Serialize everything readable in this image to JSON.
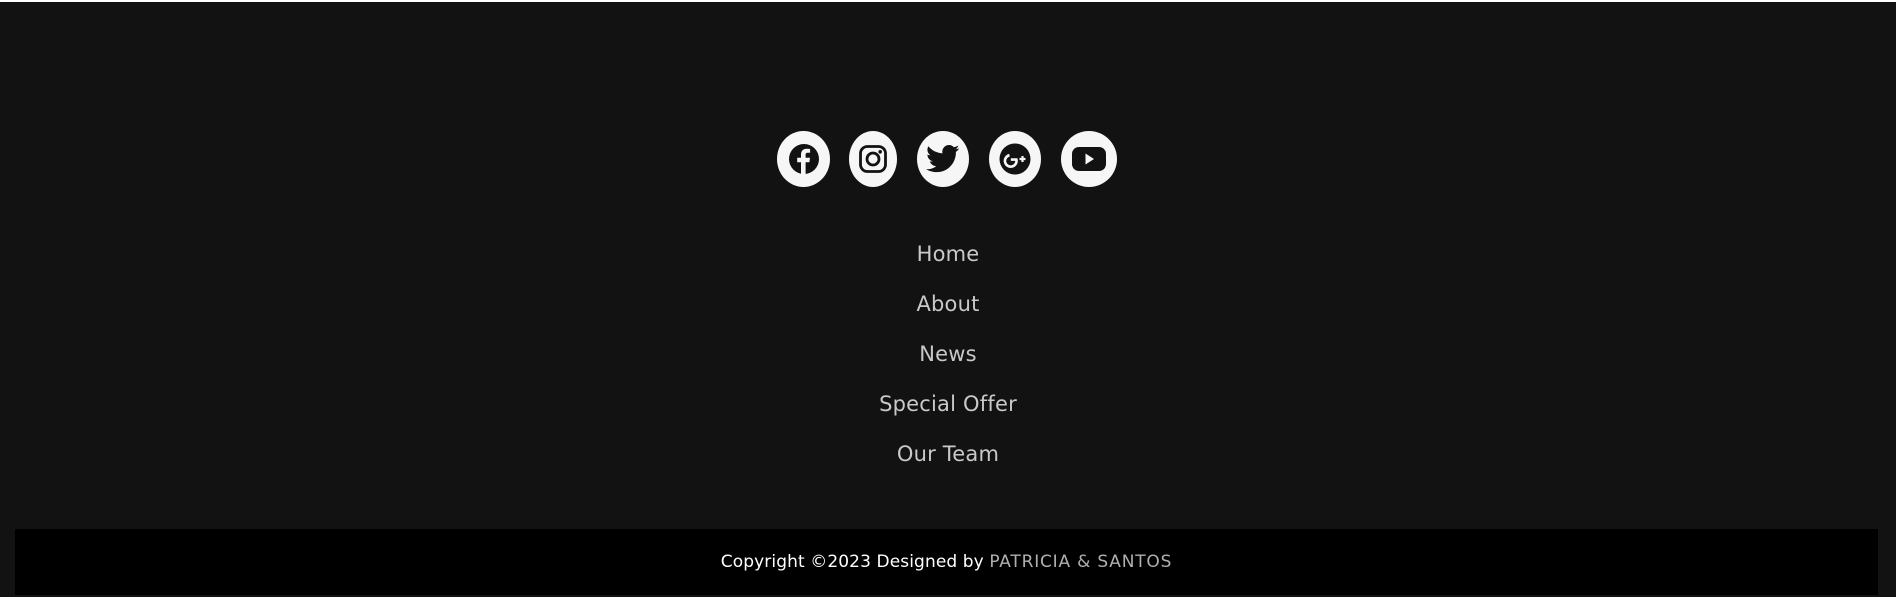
{
  "social": [
    {
      "name": "facebook-icon",
      "label": "Facebook"
    },
    {
      "name": "instagram-icon",
      "label": "Instagram"
    },
    {
      "name": "twitter-icon",
      "label": "Twitter"
    },
    {
      "name": "google-plus-icon",
      "label": "Google+"
    },
    {
      "name": "youtube-icon",
      "label": "YouTube"
    }
  ],
  "nav": {
    "items": [
      {
        "label": "Home"
      },
      {
        "label": "About"
      },
      {
        "label": "News"
      },
      {
        "label": "Special Offer"
      },
      {
        "label": "Our Team"
      }
    ]
  },
  "footer": {
    "copyright_prefix": "Copyright ©2023 Designed by ",
    "author": "PATRICIA & SANTOS"
  },
  "colors": {
    "background": "#121212",
    "bottom_bar": "#000000",
    "icon_circle": "#f6f6f6",
    "icon_glyph": "#121212",
    "nav_text": "#c9c9c9",
    "author_text": "#b0b0b0"
  }
}
